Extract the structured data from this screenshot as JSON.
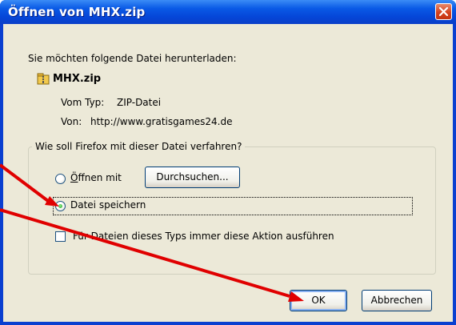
{
  "dialog": {
    "title": "Öffnen von MHX.zip",
    "prompt": "Sie möchten folgende Datei herunterladen:",
    "file_name": "MHX.zip",
    "type_label": "Vom Typ:",
    "type_value": "ZIP-Datei",
    "from_label": "Von:",
    "from_value": "http://www.gratisgames24.de",
    "group_label": "Wie soll Firefox mit dieser Datei verfahren?",
    "open_with_label": "Öffnen mit",
    "browse_button": "Durchsuchen...",
    "save_label": "Datei speichern",
    "always_label": "Für Dateien dieses Typs immer diese Aktion ausführen",
    "ok_button": "OK",
    "cancel_button": "Abbrechen",
    "selected_option": "Datei speichern",
    "always_checked": false
  },
  "icons": {
    "close": "close-icon",
    "file": "zip-file-icon"
  },
  "colors": {
    "titlebar": "#0a5ae6",
    "client": "#ece9d8",
    "close": "#d4421f",
    "annotation_arrow": "#e00000"
  }
}
